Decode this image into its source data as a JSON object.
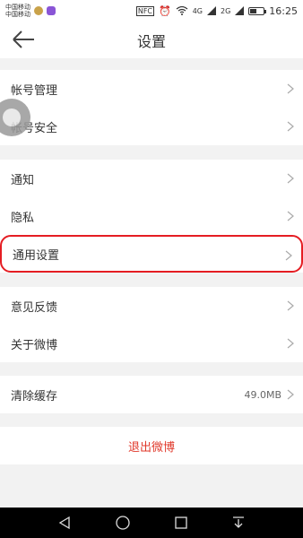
{
  "status": {
    "carrier_1": "中国移动",
    "carrier_2": "中国移动",
    "nfc": "NFC",
    "net_4g": "4G",
    "net_2g": "2G",
    "time": "16:25"
  },
  "header": {
    "title": "设置"
  },
  "groups": [
    {
      "items": [
        {
          "label": "帐号管理"
        },
        {
          "label": "帐号安全"
        }
      ]
    },
    {
      "items": [
        {
          "label": "通知"
        },
        {
          "label": "隐私"
        },
        {
          "label": "通用设置"
        }
      ]
    },
    {
      "items": [
        {
          "label": "意见反馈"
        },
        {
          "label": "关于微博"
        }
      ]
    },
    {
      "items": [
        {
          "label": "清除缓存",
          "value": "49.0MB"
        }
      ]
    },
    {
      "items": [
        {
          "label": "退出微博"
        }
      ]
    }
  ],
  "colors": {
    "accent_red": "#e0392b",
    "highlight_border": "#e51d23"
  },
  "icons": [
    "back-arrow-icon",
    "chevron-right-icon",
    "nav-back-icon",
    "nav-home-icon",
    "nav-recents-icon",
    "nav-notification-icon"
  ]
}
